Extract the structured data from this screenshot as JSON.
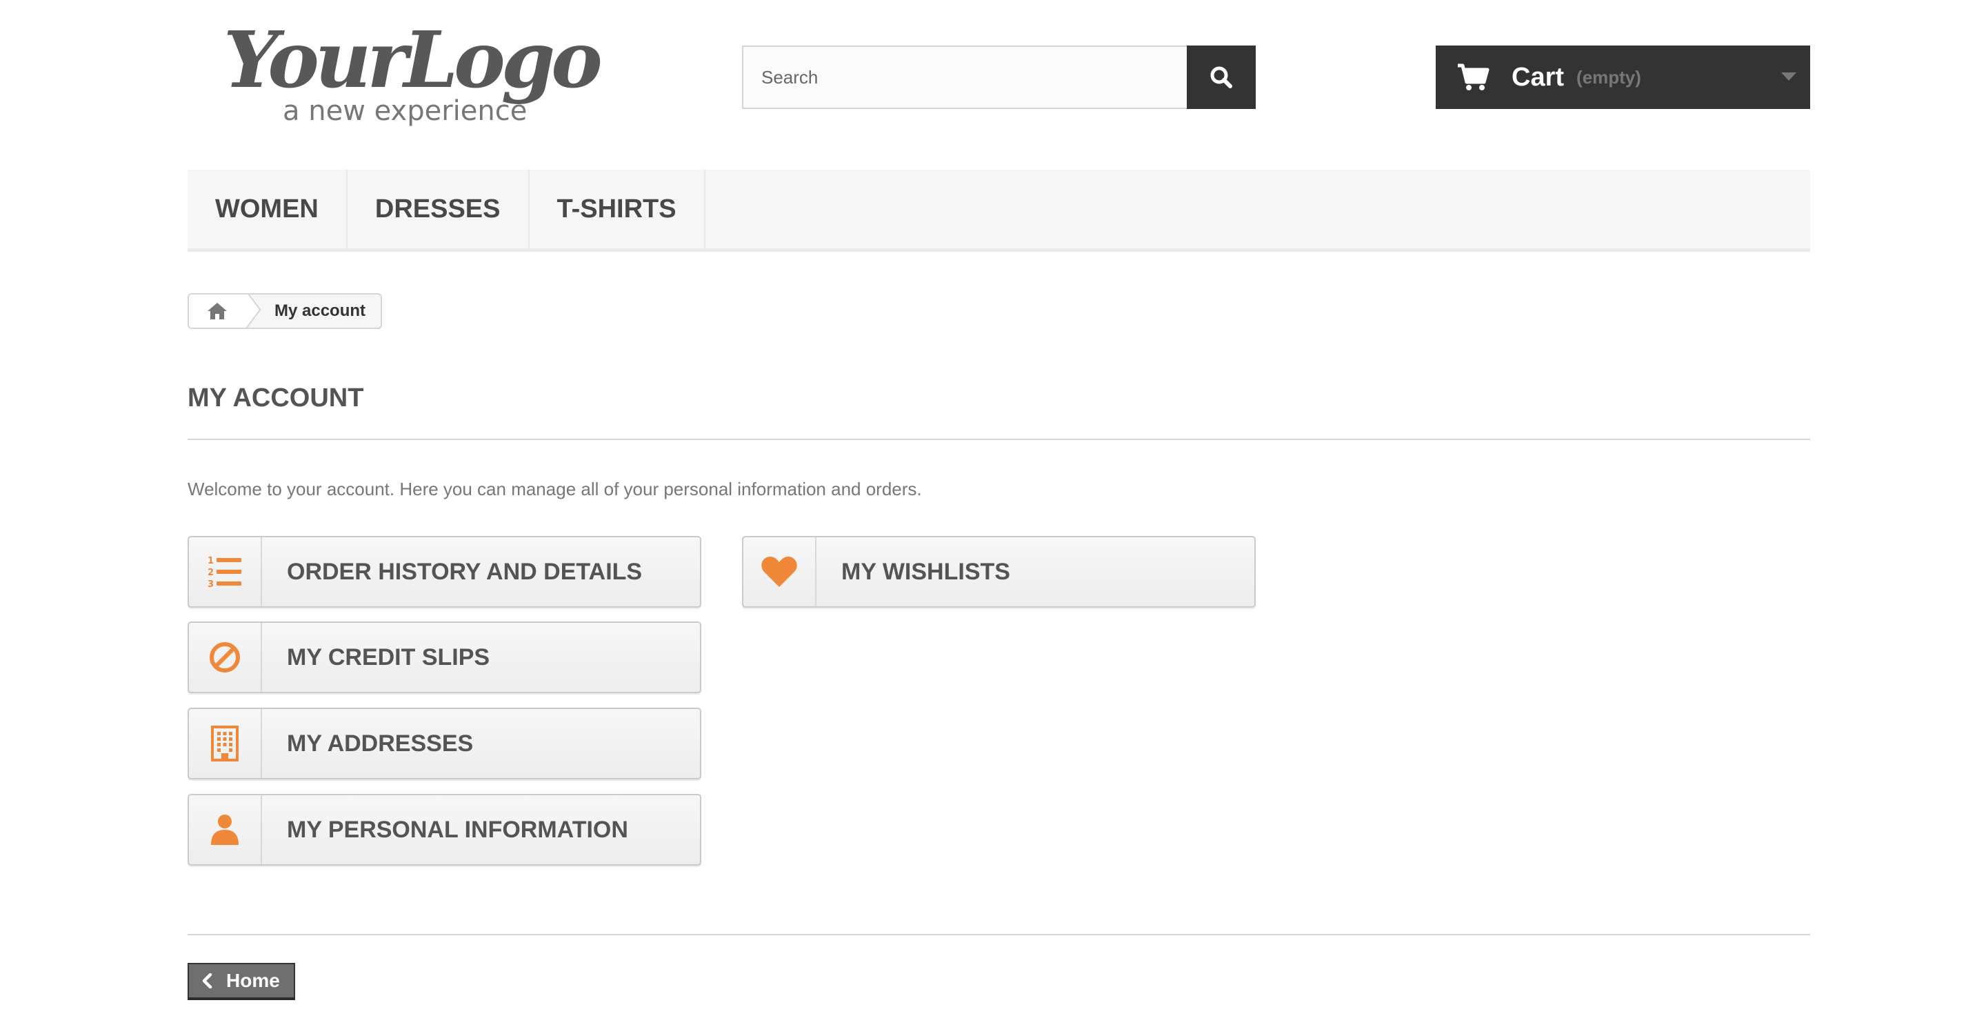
{
  "header": {
    "logo": {
      "title": "YourLogo",
      "tagline": "a new experience"
    },
    "search": {
      "placeholder": "Search",
      "value": ""
    },
    "cart": {
      "label": "Cart",
      "status": "(empty)"
    }
  },
  "menu": {
    "items": [
      {
        "label": "WOMEN"
      },
      {
        "label": "DRESSES"
      },
      {
        "label": "T-SHIRTS"
      }
    ]
  },
  "breadcrumb": {
    "home_icon": "home-icon",
    "current": "My account"
  },
  "account": {
    "title": "MY ACCOUNT",
    "welcome": "Welcome to your account. Here you can manage all of your personal information and orders.",
    "links": [
      {
        "label": "ORDER HISTORY AND DETAILS",
        "icon": "ordered-list-icon"
      },
      {
        "label": "MY CREDIT SLIPS",
        "icon": "ban-icon"
      },
      {
        "label": "MY ADDRESSES",
        "icon": "building-icon"
      },
      {
        "label": "MY PERSONAL INFORMATION",
        "icon": "user-icon"
      },
      {
        "label": "MY WISHLISTS",
        "icon": "heart-icon"
      }
    ]
  },
  "footer": {
    "home_label": "Home"
  },
  "colors": {
    "accent": "#f0883a",
    "dark": "#333333",
    "menu_bg": "#f6f6f6",
    "border": "#d6d4d4"
  }
}
